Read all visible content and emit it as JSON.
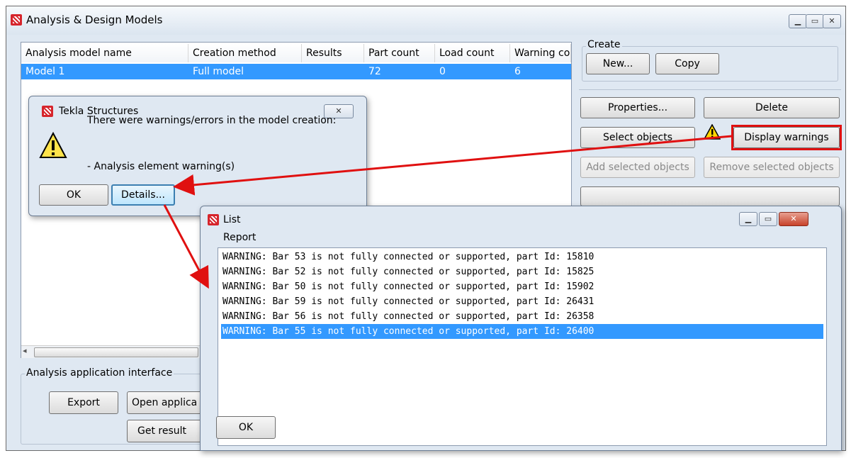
{
  "main_window": {
    "title": "Analysis & Design Models",
    "table": {
      "headers": [
        "Analysis model name",
        "Creation method",
        "Results",
        "Part count",
        "Load count",
        "Warning co"
      ],
      "rows": [
        {
          "name": "Model 1",
          "method": "Full model",
          "results": "",
          "parts": "72",
          "loads": "0",
          "warnings": "6"
        }
      ]
    },
    "create_group": {
      "label": "Create",
      "new_label": "New...",
      "copy_label": "Copy"
    },
    "properties_label": "Properties...",
    "delete_label": "Delete",
    "select_objects_label": "Select objects",
    "display_warnings_label": "Display warnings",
    "add_selected_label": "Add selected objects",
    "remove_selected_label": "Remove selected objects",
    "interface_group": {
      "label": "Analysis application interface",
      "export_label": "Export",
      "open_app_label": "Open applica",
      "get_results_label": "Get result"
    }
  },
  "warning_dialog": {
    "title": "Tekla Structures",
    "message": "There were warnings/errors in the model creation:",
    "detail": "- Analysis element warning(s)",
    "ok_label": "OK",
    "details_label": "Details..."
  },
  "list_window": {
    "title": "List",
    "group_label": "Report",
    "lines": [
      "WARNING: Bar 53 is not fully connected or supported, part Id: 15810",
      "WARNING: Bar 52 is not fully connected or supported, part Id: 15825",
      "WARNING: Bar 50 is not fully connected or supported, part Id: 15902",
      "WARNING: Bar 59 is not fully connected or supported, part Id: 26431",
      "WARNING: Bar 56 is not fully connected or supported, part Id: 26358",
      "WARNING: Bar 55 is not fully connected or supported, part Id: 26400"
    ],
    "selected_index": 5,
    "ok_label": "OK"
  },
  "colors": {
    "selection": "#3399ff",
    "annotation": "#e01010"
  }
}
